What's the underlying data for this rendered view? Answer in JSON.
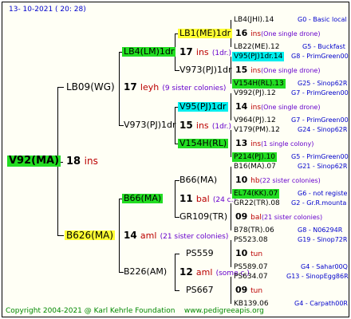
{
  "header": {
    "date": "13- 10-2021 ( 20: 28)"
  },
  "footer": {
    "copyright": "Copyright 2004-2021 @ Karl Kehrle Foundation",
    "site": "www.pedigreeapis.org"
  },
  "colors": {
    "queen": "#ffff33",
    "green": "#22dd22",
    "cyan": "#00eeee",
    "generation": "#bb0000",
    "note": "#6600cc",
    "source": "#0000cc"
  },
  "root": {
    "name": "V92(MA)",
    "generation": {
      "num": "18",
      "label": "ins"
    }
  },
  "upper": {
    "name": "LB09(WG)",
    "generation": {
      "num": "17",
      "label": "leyh",
      "note": "(9 sister colonies)"
    },
    "dam1": {
      "name": "LB4(LM)1dr",
      "generation": {
        "num": "17",
        "label": "ins",
        "note": "(1dr.)"
      },
      "sub1": {
        "name": "LB1(ME)1dr",
        "generation": {
          "num": "16",
          "label": "ins",
          "note": "(One single drone)"
        }
      },
      "sub2": {
        "name": "V973(PJ)1dr",
        "generation": {
          "num": "15",
          "label": "ins",
          "note": "(One single drone)"
        }
      }
    },
    "dam2": {
      "name": "V973(PJ)1dr",
      "generation": {
        "num": "15",
        "label": "ins",
        "note": "(1dr.)"
      },
      "sub1": {
        "name": "V95(PJ)1dr",
        "generation": {
          "num": "14",
          "label": "ins",
          "note": "(One single drone)"
        }
      },
      "sub2": {
        "name": "V154H(RL)",
        "generation": {
          "num": "13",
          "label": "ins",
          "note": "(1 single colony)"
        }
      }
    }
  },
  "lower": {
    "name": "B626(MA)",
    "generation": {
      "num": "14",
      "label": "aml",
      "note": "(21 sister colonies)"
    },
    "dam1": {
      "name": "B66(MA)",
      "generation": {
        "num": "11",
        "label": "bal",
        "note": "(24 c.)"
      },
      "sub1": {
        "name": "B66(MA)",
        "generation": {
          "num": "10",
          "label": "hb",
          "note": "(22 sister colonies)"
        }
      },
      "sub2": {
        "name": "GR109(TR)",
        "generation": {
          "num": "09",
          "label": "bal",
          "note": "(21 sister colonies)"
        }
      }
    },
    "dam2": {
      "name": "B226(AM)",
      "generation": {
        "num": "12",
        "label": "aml",
        "note": "(some c.)"
      },
      "sub1": {
        "name": "PS559",
        "generation": {
          "num": "10",
          "label": "tun",
          "note": ""
        }
      },
      "sub2": {
        "name": "PS667",
        "generation": {
          "num": "09",
          "label": "tun",
          "note": ""
        }
      }
    }
  },
  "leaves": [
    {
      "name": "LB4(JHI).14",
      "source": "G0 - Basic local"
    },
    {
      "name": "LB22(ME).12",
      "source": "G5 - Buckfast"
    },
    {
      "name": "V95(PJ)1dr.14",
      "source": "G8 - PrimGreen00"
    },
    {
      "name": "V154H(RL).13",
      "source": "G25 - Sinop62R"
    },
    {
      "name": "V992(PJ).12",
      "source": "G7 - PrimGreen00"
    },
    {
      "name": "V964(PJ).12",
      "source": "G7 - PrimGreen00"
    },
    {
      "name": "V179(PM).12",
      "source": "G24 - Sinop62R"
    },
    {
      "name": "P214(PJ).10",
      "source": "G5 - PrimGreen00"
    },
    {
      "name": "B16(MA).07",
      "source": "G21 - Sinop62R"
    },
    {
      "name": "EL74(KK).07",
      "source": "G6 - not registe"
    },
    {
      "name": "GR22(TR).08",
      "source": "G2 - Gr.R.mounta"
    },
    {
      "name": "B78(TR).06",
      "source": "G8 - N06294R"
    },
    {
      "name": "PS523.08",
      "source": "G19 - Sinop72R"
    },
    {
      "name": "PS589.07",
      "source": "G4 - Sahar00Q"
    },
    {
      "name": "PS634.07",
      "source": "G13 - SinopEgg86R"
    },
    {
      "name": "KB139.06",
      "source": "G4 - Carpath00R"
    }
  ]
}
